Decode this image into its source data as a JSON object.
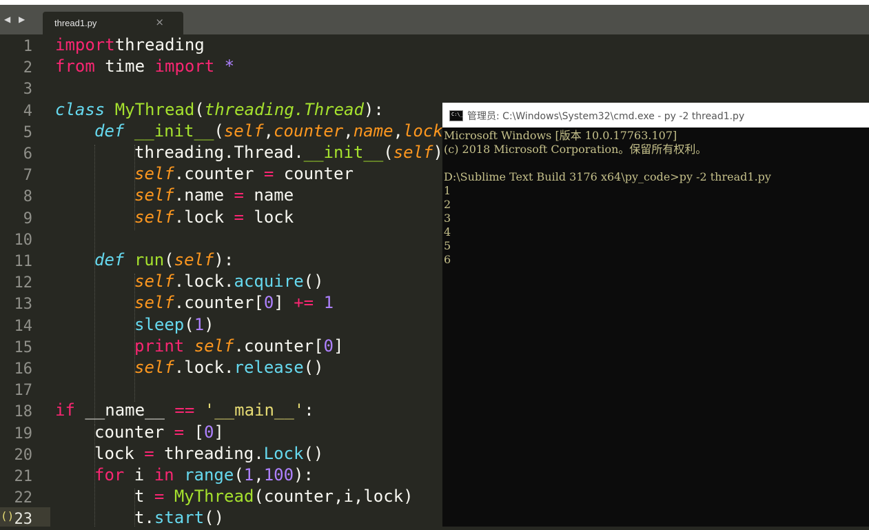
{
  "menubar": {
    "fragment": ""
  },
  "tabbar": {
    "nav_arrows": "◀ ▶",
    "tab_title": "thread1.py",
    "tab_close": "×"
  },
  "gutter": {
    "line_numbers": [
      "1",
      "2",
      "3",
      "4",
      "5",
      "6",
      "7",
      "8",
      "9",
      "10",
      "11",
      "12",
      "13",
      "14",
      "15",
      "16",
      "17",
      "18",
      "19",
      "20",
      "21",
      "22",
      "23"
    ],
    "bracket_mark": "()"
  },
  "code_lines": [
    [
      [
        "kw",
        "import"
      ],
      [
        "",
        "threading"
      ]
    ],
    [
      [
        "kw",
        "from"
      ],
      [
        "",
        " time "
      ],
      [
        "kw",
        "import"
      ],
      [
        "",
        " "
      ],
      [
        "num",
        "*"
      ]
    ],
    [],
    [
      [
        "st",
        "class"
      ],
      [
        "",
        " "
      ],
      [
        "cls",
        "MyThread"
      ],
      [
        "",
        "("
      ],
      [
        "inh",
        "threading.Thread"
      ],
      [
        "",
        "):"
      ]
    ],
    [
      [
        "",
        ""
      ],
      [
        "st",
        "def"
      ],
      [
        "",
        " "
      ],
      [
        "cls",
        "__init__"
      ],
      [
        "",
        "("
      ],
      [
        "par",
        "self"
      ],
      [
        "",
        ","
      ],
      [
        "par",
        "counter"
      ],
      [
        "",
        ","
      ],
      [
        "par",
        "name"
      ],
      [
        "",
        ","
      ],
      [
        "par",
        "lock"
      ],
      [
        "",
        ")"
      ]
    ],
    [
      [
        "",
        ""
      ],
      [
        "",
        "threading.Thread."
      ],
      [
        "cls",
        "__init__"
      ],
      [
        "",
        "("
      ],
      [
        "par",
        "self"
      ],
      [
        "",
        ")"
      ]
    ],
    [
      [
        "",
        ""
      ],
      [
        "par",
        "self"
      ],
      [
        "",
        ".counter "
      ],
      [
        "kw",
        "="
      ],
      [
        "",
        " counter"
      ]
    ],
    [
      [
        "",
        ""
      ],
      [
        "par",
        "self"
      ],
      [
        "",
        ".name "
      ],
      [
        "kw",
        "="
      ],
      [
        "",
        " name"
      ]
    ],
    [
      [
        "",
        ""
      ],
      [
        "par",
        "self"
      ],
      [
        "",
        ".lock "
      ],
      [
        "kw",
        "="
      ],
      [
        "",
        " lock"
      ]
    ],
    [],
    [
      [
        "",
        ""
      ],
      [
        "st",
        "def"
      ],
      [
        "",
        " "
      ],
      [
        "cls",
        "run"
      ],
      [
        "",
        "("
      ],
      [
        "par",
        "self"
      ],
      [
        "",
        "):"
      ]
    ],
    [
      [
        "",
        ""
      ],
      [
        "par",
        "self"
      ],
      [
        "",
        ".lock."
      ],
      [
        "fn",
        "acquire"
      ],
      [
        "",
        "()"
      ]
    ],
    [
      [
        "",
        ""
      ],
      [
        "par",
        "self"
      ],
      [
        "",
        ".counter["
      ],
      [
        "num",
        "0"
      ],
      [
        "",
        "] "
      ],
      [
        "kw",
        "+="
      ],
      [
        "",
        " "
      ],
      [
        "num",
        "1"
      ]
    ],
    [
      [
        "",
        ""
      ],
      [
        "fn",
        "sleep"
      ],
      [
        "",
        "("
      ],
      [
        "num",
        "1"
      ],
      [
        "",
        ")"
      ]
    ],
    [
      [
        "",
        ""
      ],
      [
        "kw",
        "print"
      ],
      [
        "",
        " "
      ],
      [
        "par",
        "self"
      ],
      [
        "",
        ".counter["
      ],
      [
        "num",
        "0"
      ],
      [
        "",
        "]"
      ]
    ],
    [
      [
        "",
        ""
      ],
      [
        "par",
        "self"
      ],
      [
        "",
        ".lock."
      ],
      [
        "fn",
        "release"
      ],
      [
        "",
        "()"
      ]
    ],
    [],
    [
      [
        "kw",
        "if"
      ],
      [
        "",
        " __name__ "
      ],
      [
        "kw",
        "=="
      ],
      [
        "",
        " "
      ],
      [
        "str",
        "'__main__'"
      ],
      [
        "",
        ":"
      ]
    ],
    [
      [
        "",
        ""
      ],
      [
        "",
        "counter "
      ],
      [
        "kw",
        "="
      ],
      [
        "",
        " ["
      ],
      [
        "num",
        "0"
      ],
      [
        "",
        "]"
      ]
    ],
    [
      [
        "",
        ""
      ],
      [
        "",
        "lock "
      ],
      [
        "kw",
        "="
      ],
      [
        "",
        " threading."
      ],
      [
        "fn",
        "Lock"
      ],
      [
        "",
        "()"
      ]
    ],
    [
      [
        "",
        ""
      ],
      [
        "kw",
        "for"
      ],
      [
        "",
        " i "
      ],
      [
        "kw",
        "in"
      ],
      [
        "",
        " "
      ],
      [
        "fn",
        "range"
      ],
      [
        "",
        "("
      ],
      [
        "num",
        "1"
      ],
      [
        "",
        ","
      ],
      [
        "num",
        "100"
      ],
      [
        "",
        "):"
      ]
    ],
    [
      [
        "",
        ""
      ],
      [
        "",
        "t "
      ],
      [
        "kw",
        "="
      ],
      [
        "",
        " "
      ],
      [
        "cls",
        "MyThread"
      ],
      [
        "",
        "(counter,i,lock)"
      ]
    ],
    [
      [
        "",
        ""
      ],
      [
        "",
        "t."
      ],
      [
        "fn",
        "start"
      ],
      [
        "",
        "()"
      ]
    ]
  ],
  "cmd": {
    "icon_text": "C:\\_",
    "title": "管理员: C:\\Windows\\System32\\cmd.exe - py  -2 thread1.py",
    "lines": [
      "Microsoft Windows [版本 10.0.17763.107]",
      "(c) 2018 Microsoft Corporation。保留所有权利。",
      "",
      "D:\\Sublime Text Build 3176 x64\\py_code>py -2 thread1.py",
      "1",
      "2",
      "3",
      "4",
      "5",
      "6"
    ]
  },
  "colors": {
    "editor_bg": "#272822",
    "keyword": "#f92672",
    "storage": "#66d9ef",
    "class_name": "#a6e22e",
    "parameter": "#fd971f",
    "number": "#ae81ff",
    "string": "#e6db74",
    "cmd_bg": "#0c0c0c",
    "cmd_text": "#c5c08a"
  }
}
